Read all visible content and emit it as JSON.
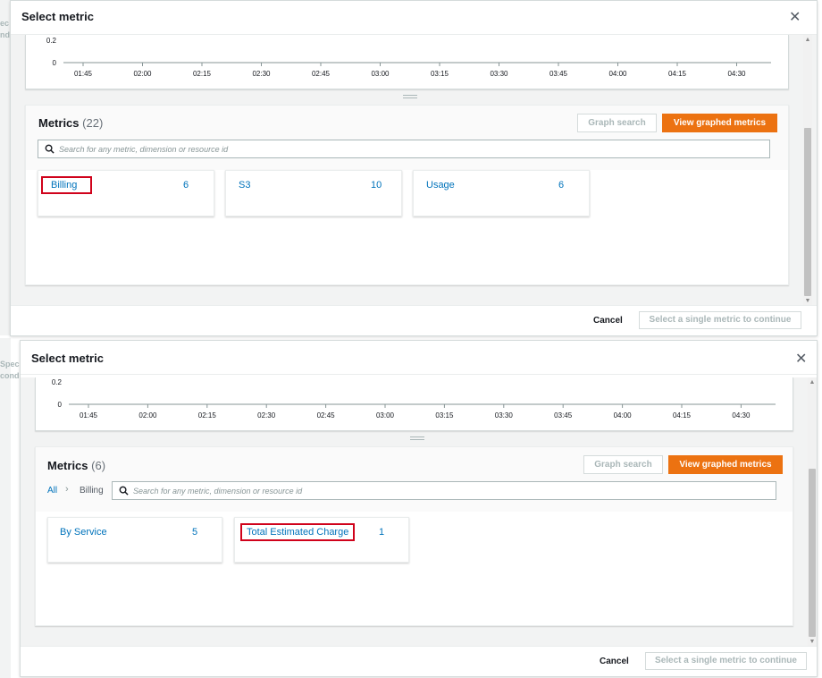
{
  "modals": [
    {
      "title": "Select metric",
      "graph": {
        "y_labels": [
          "0.2",
          "0"
        ],
        "x_labels": [
          "01:45",
          "02:00",
          "02:15",
          "02:30",
          "02:45",
          "03:00",
          "03:15",
          "03:30",
          "03:45",
          "04:00",
          "04:15",
          "04:30"
        ]
      },
      "metrics": {
        "title": "Metrics",
        "count": "(22)",
        "graph_search_label": "Graph search",
        "view_graphed_label": "View graphed metrics",
        "search_placeholder": "Search for any metric, dimension or resource id",
        "cards": [
          {
            "label": "Billing",
            "count": "6",
            "highlighted": true
          },
          {
            "label": "S3",
            "count": "10",
            "highlighted": false
          },
          {
            "label": "Usage",
            "count": "6",
            "highlighted": false
          }
        ]
      },
      "footer": {
        "cancel_label": "Cancel",
        "continue_label": "Select a single metric to continue"
      }
    },
    {
      "title": "Select metric",
      "graph": {
        "y_labels": [
          "0.2",
          "0"
        ],
        "x_labels": [
          "01:45",
          "02:00",
          "02:15",
          "02:30",
          "02:45",
          "03:00",
          "03:15",
          "03:30",
          "03:45",
          "04:00",
          "04:15",
          "04:30"
        ]
      },
      "metrics": {
        "title": "Metrics",
        "count": "(6)",
        "graph_search_label": "Graph search",
        "view_graphed_label": "View graphed metrics",
        "breadcrumb_all": "All",
        "breadcrumb_current": "Billing",
        "search_placeholder": "Search for any metric, dimension or resource id",
        "cards": [
          {
            "label": "By Service",
            "count": "5",
            "highlighted": false
          },
          {
            "label": "Total Estimated Charge",
            "count": "1",
            "highlighted": true
          }
        ]
      },
      "footer": {
        "cancel_label": "Cancel",
        "continue_label": "Select a single metric to continue"
      }
    }
  ],
  "background_fragments": [
    "ec",
    "nd",
    "Spec",
    "cond"
  ],
  "colors": {
    "accent_orange": "#ec7211",
    "link_blue": "#0073bb",
    "highlight_red": "#d0021b"
  },
  "icons": {
    "close": "close-icon",
    "search": "search-icon",
    "breadcrumb_separator": "chevron-right-icon"
  }
}
